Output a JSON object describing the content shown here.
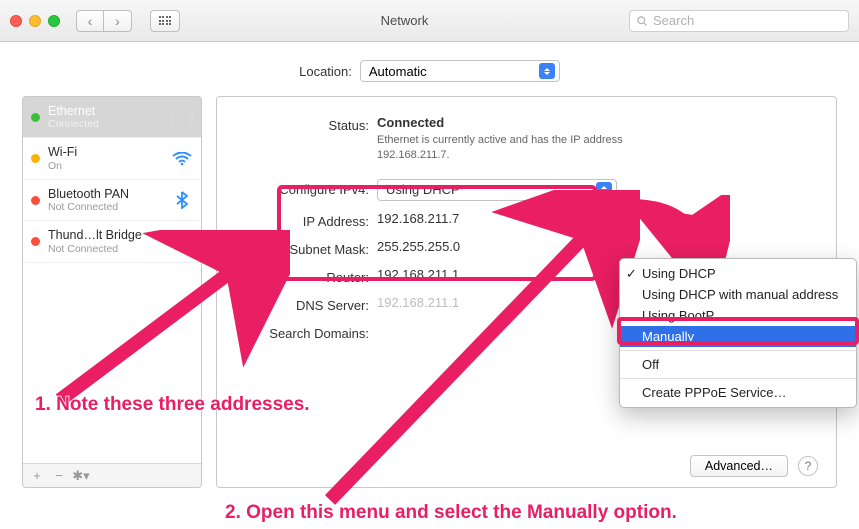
{
  "window": {
    "title": "Network",
    "search_placeholder": "Search"
  },
  "location": {
    "label": "Location:",
    "value": "Automatic"
  },
  "sidebar": {
    "items": [
      {
        "name": "Ethernet",
        "sub": "Connected",
        "status": "green",
        "selected": true,
        "icon": "ethernet"
      },
      {
        "name": "Wi-Fi",
        "sub": "On",
        "status": "amber",
        "selected": false,
        "icon": "wifi"
      },
      {
        "name": "Bluetooth PAN",
        "sub": "Not Connected",
        "status": "red",
        "selected": false,
        "icon": "bluetooth"
      },
      {
        "name": "Thund…lt Bridge",
        "sub": "Not Connected",
        "status": "red",
        "selected": false,
        "icon": "thunderbolt"
      }
    ]
  },
  "details": {
    "status_label": "Status:",
    "status_value": "Connected",
    "status_desc": "Ethernet is currently active and has the IP address 192.168.211.7.",
    "configure_label": "Configure IPv4:",
    "configure_value": "Using DHCP",
    "ip_label": "IP Address:",
    "ip_value": "192.168.211.7",
    "subnet_label": "Subnet Mask:",
    "subnet_value": "255.255.255.0",
    "router_label": "Router:",
    "router_value": "192.168.211.1",
    "dns_label": "DNS Server:",
    "dns_value": "192.168.211.1",
    "search_label": "Search Domains:",
    "search_value": "",
    "advanced": "Advanced…"
  },
  "menu": {
    "items": [
      {
        "label": "Using DHCP",
        "checked": true
      },
      {
        "label": "Using DHCP with manual address"
      },
      {
        "label": "Using BootP"
      },
      {
        "label": "Manually",
        "highlight": true
      },
      {
        "label": "Off",
        "sepBefore": true
      },
      {
        "label": "Create PPPoE Service…",
        "sepBefore": true
      }
    ]
  },
  "annotations": {
    "a1": "1. Note these three addresses.",
    "a2": "2. Open this menu and select the Manually option."
  }
}
